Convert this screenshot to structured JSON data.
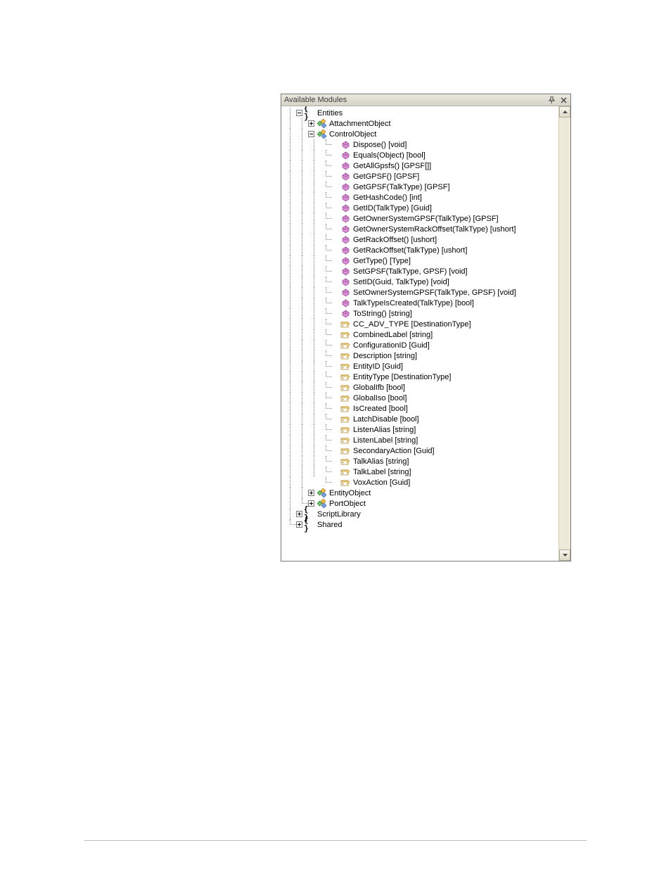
{
  "panel": {
    "title": "Available Modules"
  },
  "tree": {
    "entities_label": "Entities",
    "attachment_label": "AttachmentObject",
    "control_label": "ControlObject",
    "control_members": [
      {
        "kind": "method",
        "text": "Dispose() [void]"
      },
      {
        "kind": "method",
        "text": "Equals(Object) [bool]"
      },
      {
        "kind": "method",
        "text": "GetAllGpsfs() [GPSF[]]"
      },
      {
        "kind": "method",
        "text": "GetGPSF() [GPSF]"
      },
      {
        "kind": "method",
        "text": "GetGPSF(TalkType) [GPSF]"
      },
      {
        "kind": "method",
        "text": "GetHashCode() [int]"
      },
      {
        "kind": "method",
        "text": "GetID(TalkType) [Guid]"
      },
      {
        "kind": "method",
        "text": "GetOwnerSystemGPSF(TalkType) [GPSF]"
      },
      {
        "kind": "method",
        "text": "GetOwnerSystemRackOffset(TalkType) [ushort]"
      },
      {
        "kind": "method",
        "text": "GetRackOffset() [ushort]"
      },
      {
        "kind": "method",
        "text": "GetRackOffset(TalkType) [ushort]"
      },
      {
        "kind": "method",
        "text": "GetType() [Type]"
      },
      {
        "kind": "method",
        "text": "SetGPSF(TalkType, GPSF) [void]"
      },
      {
        "kind": "method",
        "text": "SetID(Guid, TalkType) [void]"
      },
      {
        "kind": "method",
        "text": "SetOwnerSystemGPSF(TalkType, GPSF) [void]"
      },
      {
        "kind": "method",
        "text": "TalkTypeIsCreated(TalkType) [bool]"
      },
      {
        "kind": "method",
        "text": "ToString() [string]"
      },
      {
        "kind": "prop",
        "text": "CC_ADV_TYPE [DestinationType]"
      },
      {
        "kind": "prop",
        "text": "CombinedLabel [string]"
      },
      {
        "kind": "prop",
        "text": "ConfigurationID [Guid]"
      },
      {
        "kind": "prop",
        "text": "Description [string]"
      },
      {
        "kind": "prop",
        "text": "EntityID [Guid]"
      },
      {
        "kind": "prop",
        "text": "EntityType [DestinationType]"
      },
      {
        "kind": "prop",
        "text": "GlobalIfb [bool]"
      },
      {
        "kind": "prop",
        "text": "GlobalIso [bool]"
      },
      {
        "kind": "prop",
        "text": "IsCreated [bool]"
      },
      {
        "kind": "prop",
        "text": "LatchDisable [bool]"
      },
      {
        "kind": "prop",
        "text": "ListenAlias [string]"
      },
      {
        "kind": "prop",
        "text": "ListenLabel [string]"
      },
      {
        "kind": "prop",
        "text": "SecondaryAction [Guid]"
      },
      {
        "kind": "prop",
        "text": "TalkAlias [string]"
      },
      {
        "kind": "prop",
        "text": "TalkLabel [string]"
      },
      {
        "kind": "prop",
        "text": "VoxAction [Guid]"
      }
    ],
    "entityobject_label": "EntityObject",
    "portobject_label": "PortObject",
    "scriptlib_label": "ScriptLibrary",
    "shared_label": "Shared"
  }
}
